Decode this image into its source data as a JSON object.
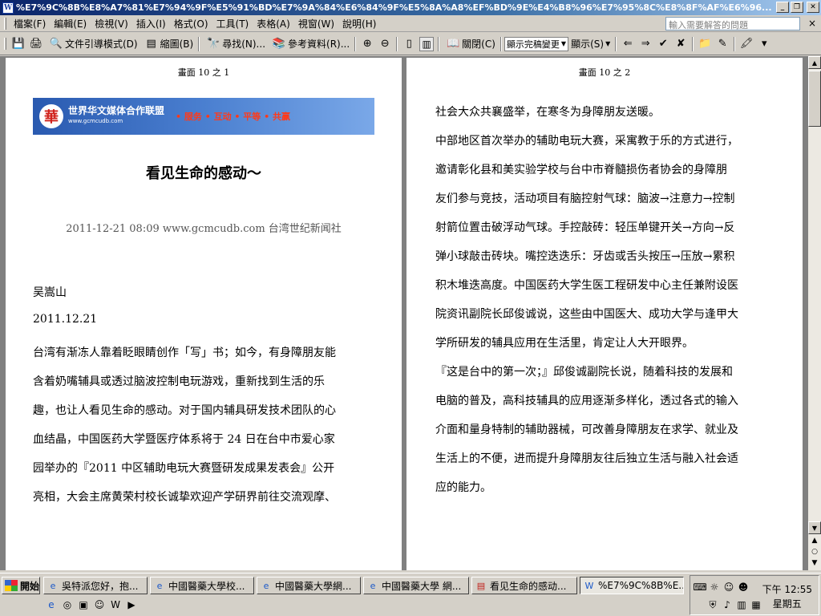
{
  "window": {
    "title": "%E7%9C%8B%E8%A7%81%E7%94%9F%E5%91%BD%E7%9A%84%E6%84%9F%E5%8A%A8%EF%BD%9E%E4%B8%96%E7%95%8C%E8%8F%AF%E6%96..."
  },
  "menu": {
    "items": [
      "檔案(F)",
      "編輯(E)",
      "檢視(V)",
      "插入(I)",
      "格式(O)",
      "工具(T)",
      "表格(A)",
      "視窗(W)",
      "說明(H)"
    ],
    "help_placeholder": "輸入需要解答的問題",
    "close_glyph": "×"
  },
  "toolbar": {
    "doc_map": "文件引導模式(D)",
    "thumbnails": "縮圖(B)",
    "find": "尋找(N)...",
    "research": "參考資料(R)...",
    "close": "關閉(C)",
    "markup_select": "顯示完稿變更",
    "show": "顯示(S)"
  },
  "document": {
    "page1_label": "畫面 10 之 1",
    "page2_label": "畫面 10 之 2",
    "banner": {
      "logo_glyph": "華",
      "name": "世界华文媒体合作联盟",
      "url": "www.gcmcudb.com",
      "slogan": "• 服务  • 互动  • 平等  • 共赢"
    },
    "title": "看见生命的感动～",
    "byline": "2011-12-21 08:09  www.gcmcudb.com  台湾世纪新闻社",
    "author": "吴嵩山",
    "date": "2011.12.21",
    "page1_lines": [
      "台湾有渐冻人靠着眨眼睛创作「写」书；如今，有身障朋友能",
      "含着奶嘴辅具或透过脑波控制电玩游戏，重新找到生活的乐",
      "趣，也让人看见生命的感动。对于国内辅具研发技术团队的心",
      "血结晶，中国医药大学暨医疗体系将于 24 日在台中市爱心家",
      "园举办的『2011 中区辅助电玩大赛暨研发成果发表会』公开",
      "亮相，大会主席黄荣村校长诚挚欢迎产学研界前往交流观摩、"
    ],
    "page2_lines": [
      "社会大众共襄盛举，在寒冬为身障朋友送暖。",
      "中部地区首次举办的辅助电玩大赛，采寓教于乐的方式进行，",
      "邀请彰化县和美实验学校与台中市脊髓损伤者协会的身障朋",
      "友们参与竞技，活动项目有脑控射气球：脑波→注意力→控制",
      "射箭位置击破浮动气球。手控敲砖：轻压单键开关→方向→反",
      "弹小球敲击砖块。嘴控迭迭乐：牙齿或舌头按压→压放→累积",
      "积木堆迭高度。中国医药大学生医工程研发中心主任兼附设医",
      "院资讯副院长邱俊诚说，这些由中国医大、成功大学与逢甲大",
      "学所研发的辅具应用在生活里，肯定让人大开眼界。",
      "『这是台中的第一次；』邱俊诚副院长说，随着科技的发展和",
      "电脑的普及，高科技辅具的应用逐渐多样化，透过各式的输入",
      "介面和量身特制的辅助器械，可改善身障朋友在求学、就业及",
      "生活上的不便，进而提升身障朋友往后独立生活与融入社会适",
      "应的能力。"
    ]
  },
  "taskbar": {
    "start": "開始",
    "tasks": [
      "吳特派您好，抱...",
      "中國醫藥大學校...",
      "中國醫藥大學網...",
      "中國醫藥大學 網...",
      "看见生命的感动...",
      "%E7%9C%8B%E..."
    ],
    "time": "下午 12:55",
    "day": "星期五"
  }
}
